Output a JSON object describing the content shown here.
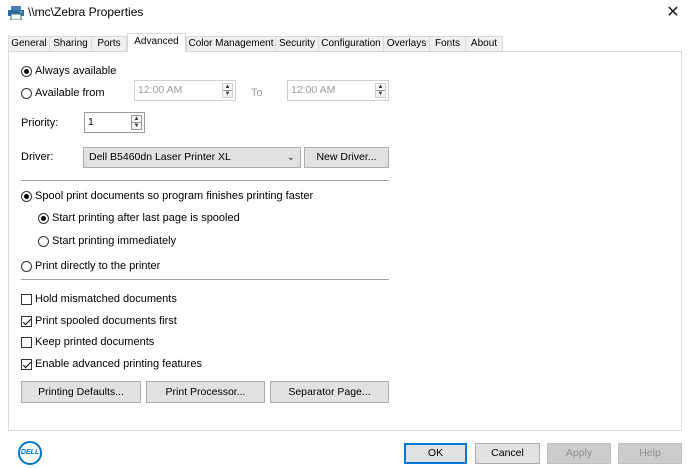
{
  "window": {
    "title": "\\\\mc\\Zebra Properties",
    "close_glyph": "✕"
  },
  "tabs": [
    {
      "label": "General"
    },
    {
      "label": "Sharing"
    },
    {
      "label": "Ports"
    },
    {
      "label": "Advanced"
    },
    {
      "label": "Color Management"
    },
    {
      "label": "Security"
    },
    {
      "label": "Configuration"
    },
    {
      "label": "Overlays"
    },
    {
      "label": "Fonts"
    },
    {
      "label": "About"
    }
  ],
  "active_tab": "Advanced",
  "availability": {
    "always_label": "Always available",
    "from_label": "Available from",
    "from_value": "12:00 AM",
    "to_label": "To",
    "to_value": "12:00 AM",
    "selected": "always"
  },
  "priority": {
    "label": "Priority:",
    "value": "1"
  },
  "driver": {
    "label": "Driver:",
    "value": "Dell B5460dn Laser Printer XL",
    "new_driver_label": "New Driver..."
  },
  "spooling": {
    "spool_label": "Spool print documents so program finishes printing faster",
    "after_last_page_label": "Start printing after last page is spooled",
    "immediately_label": "Start printing immediately",
    "direct_label": "Print directly to the printer",
    "mode": "spool",
    "start": "after_last_page"
  },
  "options": [
    {
      "label": "Hold mismatched documents",
      "checked": false
    },
    {
      "label": "Print spooled documents first",
      "checked": true
    },
    {
      "label": "Keep printed documents",
      "checked": false
    },
    {
      "label": "Enable advanced printing features",
      "checked": true
    }
  ],
  "buttons": {
    "printing_defaults": "Printing Defaults...",
    "print_processor": "Print Processor...",
    "separator_page": "Separator Page..."
  },
  "footer": {
    "logo_text": "DELL",
    "ok": "OK",
    "cancel": "Cancel",
    "apply": "Apply",
    "help": "Help"
  },
  "colors": {
    "accent": "#0078d7",
    "dell_blue": "#0076ce",
    "disabled_text": "#9b9b9b",
    "button_face": "#e1e1e1"
  }
}
